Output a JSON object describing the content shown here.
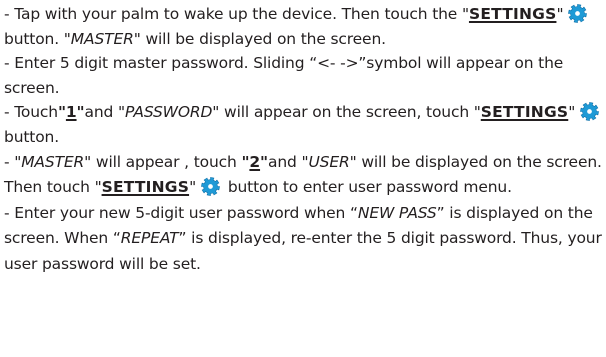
{
  "document": {
    "steps": [
      {
        "a": "- Tap with your palm to wake up the device. Then touch the ",
        "q1": "\"",
        "settings": "SETTINGS",
        "q2": "\"",
        "b": " button.  \"",
        "disp1": "MASTER",
        "c": "\" will be displayed on the screen."
      },
      {
        "a": "- Enter 5 digit master password. Sliding “<- ->”symbol will appear on the screen."
      },
      {
        "a": "- Touch",
        "num_q1": "\"",
        "num_digit": "1",
        "num_q2": "\"",
        "b": "and \"",
        "disp1": "PASSWORD",
        "c": "\" will appear on the screen, touch ",
        "q1": "\"",
        "settings": "SETTINGS",
        "q2": "\"",
        "d": " button."
      },
      {
        "a": "- \"",
        "disp1": "MASTER",
        "b": "\" will appear , touch ",
        "num_q1": "\"",
        "num_digit": "2",
        "num_q2": "\"",
        "c": "and \"",
        "disp2": "USER",
        "d": "\" will be displayed on the screen. Then touch \"",
        "settings": "SETTINGS",
        "e": "\"",
        "f": " button to enter user password menu."
      },
      {
        "a": "-  Enter your new 5-digit user password when “",
        "disp1": "NEW PASS",
        "b": "” is displayed on the screen. When “",
        "disp2": "REPEAT",
        "c": "” is displayed, re-enter the 5 digit password. Thus, your user password will be set."
      }
    ]
  },
  "icons": {
    "settings_icon": "gear-icon"
  },
  "colors": {
    "text": "#231f20",
    "gear_fill": "#1f9ad6",
    "gear_rim": "#0b6fa8",
    "gear_hole": "#ffffff"
  }
}
